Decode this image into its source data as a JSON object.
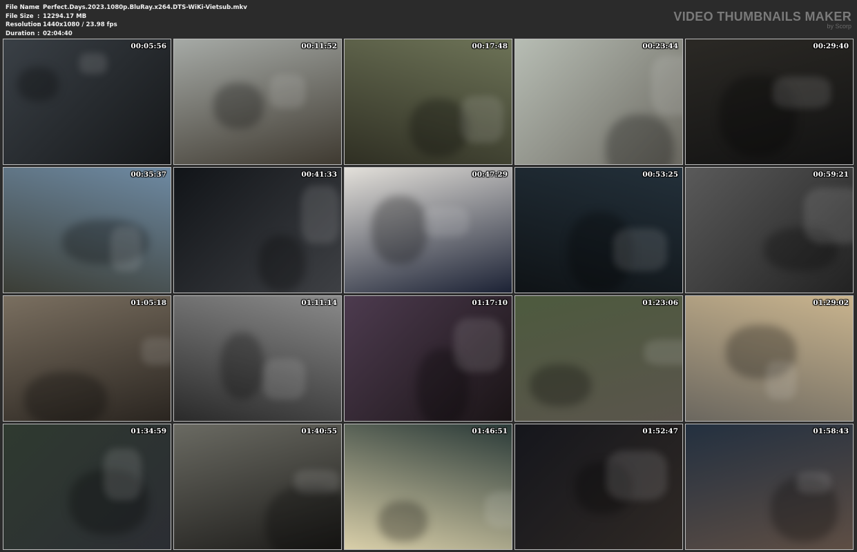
{
  "file_info": {
    "name_label": "File Name",
    "name_value": "Perfect.Days.2023.1080p.BluRay.x264.DTS-WiKi-Vietsub.mkv",
    "size_label": "File Size",
    "size_value": "12294.17 MB",
    "resolution_label": "Resolution",
    "resolution_value": "1440x1080 / 23.98 fps",
    "duration_label": "Duration",
    "duration_value": "02:04:40",
    "separator": ":"
  },
  "brand": {
    "title": "VIDEO THUMBNAILS MAKER",
    "subtitle": "by Scorp"
  },
  "thumbnails": [
    {
      "time": "00:05:56",
      "colors": [
        "#3a4046",
        "#151719"
      ]
    },
    {
      "time": "00:11:52",
      "colors": [
        "#a6aaa6",
        "#3f3a31"
      ]
    },
    {
      "time": "00:17:48",
      "colors": [
        "#6d7357",
        "#2f2f23"
      ]
    },
    {
      "time": "00:23:44",
      "colors": [
        "#b7bdb4",
        "#6c6a62"
      ]
    },
    {
      "time": "00:29:40",
      "colors": [
        "#2b2925",
        "#121212"
      ]
    },
    {
      "time": "00:35:37",
      "colors": [
        "#6e8aa3",
        "#3b3d35"
      ]
    },
    {
      "time": "00:41:33",
      "colors": [
        "#111418",
        "#3e4044"
      ]
    },
    {
      "time": "00:47:29",
      "colors": [
        "#e3e0da",
        "#1c2235"
      ]
    },
    {
      "time": "00:53:25",
      "colors": [
        "#23303a",
        "#0f1316"
      ]
    },
    {
      "time": "00:59:21",
      "colors": [
        "#5a5a5a",
        "#222"
      ]
    },
    {
      "time": "01:05:18",
      "colors": [
        "#7a6f60",
        "#2a2520"
      ]
    },
    {
      "time": "01:11:14",
      "colors": [
        "#8a8a8a",
        "#2a2a2a"
      ]
    },
    {
      "time": "01:17:10",
      "colors": [
        "#4d3b4f",
        "#1a1416"
      ]
    },
    {
      "time": "01:23:06",
      "colors": [
        "#4d5a3e",
        "#5a554c"
      ]
    },
    {
      "time": "01:29:02",
      "colors": [
        "#c9b48e",
        "#6b675f"
      ]
    },
    {
      "time": "01:34:59",
      "colors": [
        "#2f3a30",
        "#2b2d33"
      ]
    },
    {
      "time": "01:40:55",
      "colors": [
        "#6a6a62",
        "#1d1c1a"
      ]
    },
    {
      "time": "01:46:51",
      "colors": [
        "#2a3a38",
        "#d9cfa9"
      ]
    },
    {
      "time": "01:52:47",
      "colors": [
        "#15161c",
        "#2f2925"
      ]
    },
    {
      "time": "01:58:43",
      "colors": [
        "#233040",
        "#5e4e44"
      ]
    }
  ]
}
